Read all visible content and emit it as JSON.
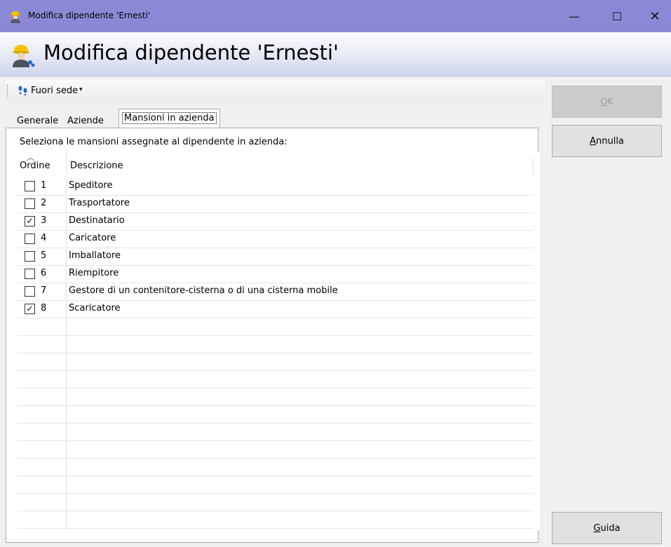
{
  "window": {
    "title": "Modifica dipendente 'Ernesti'",
    "minimize": "—",
    "maximize": "☐",
    "close": "✕"
  },
  "header": {
    "title": "Modifica dipendente 'Ernesti'"
  },
  "toolbar": {
    "fuori_sede_label": "Fuori sede",
    "caret": "▾"
  },
  "tabs": [
    {
      "label": "Generale",
      "active": false
    },
    {
      "label": "Aziende",
      "active": false
    },
    {
      "label": "Mansioni in azienda",
      "active": true
    }
  ],
  "panel": {
    "instruction": "Seleziona le mansioni assegnate al dipendente in azienda:",
    "columns": {
      "ordine": "Ordine",
      "descrizione": "Descrizione",
      "sort_indicator": "︿"
    },
    "rows": [
      {
        "num": "1",
        "desc": "Speditore",
        "checked": false
      },
      {
        "num": "2",
        "desc": "Trasportatore",
        "checked": false
      },
      {
        "num": "3",
        "desc": "Destinatario",
        "checked": true
      },
      {
        "num": "4",
        "desc": "Caricatore",
        "checked": false
      },
      {
        "num": "5",
        "desc": "Imballatore",
        "checked": false
      },
      {
        "num": "6",
        "desc": "Riempitore",
        "checked": false
      },
      {
        "num": "7",
        "desc": "Gestore di un contenitore-cisterna o di una cisterna mobile",
        "checked": false
      },
      {
        "num": "8",
        "desc": "Scaricatore",
        "checked": true
      }
    ],
    "check_mark": "✓"
  },
  "buttons": {
    "ok": {
      "mnemonic": "O",
      "rest": "K",
      "enabled": false
    },
    "annulla": {
      "mnemonic": "A",
      "rest": "nnulla"
    },
    "guida": {
      "mnemonic": "G",
      "rest": "uida"
    }
  },
  "colors": {
    "titlebar": "#8b89d6",
    "header_gradient_end": "#cfd5ec",
    "window_bg": "#f0f0f0"
  },
  "icons": [
    "worker-icon",
    "footsteps-icon"
  ]
}
